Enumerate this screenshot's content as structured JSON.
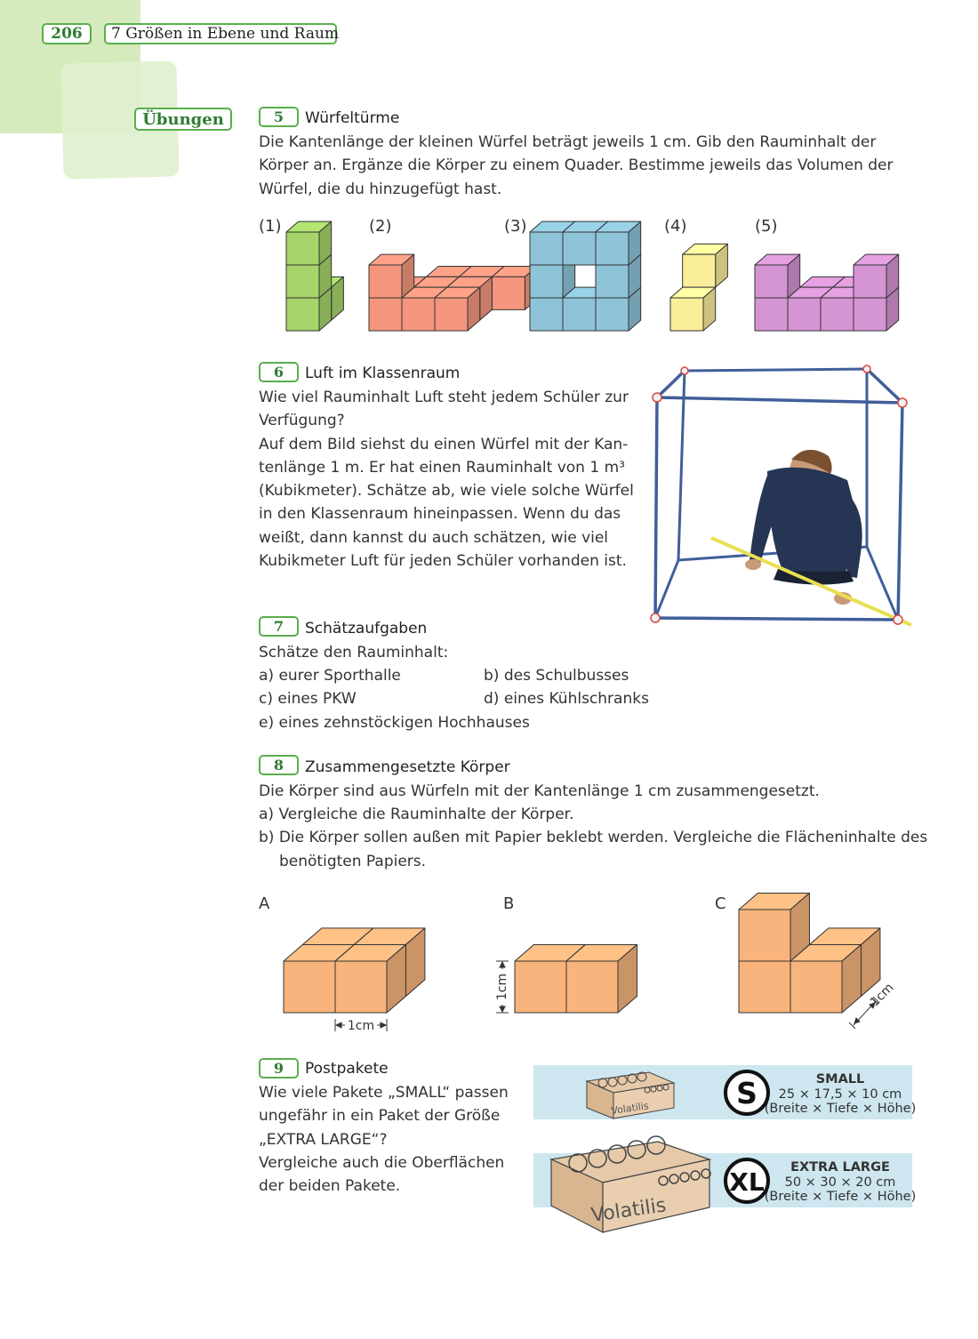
{
  "header": {
    "page_number": "206",
    "chapter": "7  Größen in Ebene und Raum"
  },
  "section_label": "Übungen",
  "ex5": {
    "num": "5",
    "title": "Würfeltürme",
    "lines": [
      "Die Kantenlänge der kleinen Würfel beträgt jeweils 1 cm. Gib den Rauminhalt der",
      "Körper an. Ergänze die Körper zu einem Quader. Bestimme jeweils das Volumen der",
      "Würfel, die du hinzugefügt hast."
    ],
    "figure_labels": [
      "(1)",
      "(2)",
      "(3)",
      "(4)",
      "(5)"
    ],
    "colors": {
      "green": "#a6d46a",
      "red": "#f4967e",
      "blue": "#8ec3d8",
      "yellow": "#fbee9a",
      "purple": "#d594d3"
    }
  },
  "ex6": {
    "num": "6",
    "title": "Luft im Klassenraum",
    "lines": [
      "Wie viel Rauminhalt Luft steht jedem Schüler zur",
      "Verfügung?",
      "Auf dem Bild siehst du einen Würfel mit der Kan-",
      "tenlänge 1 m. Er hat einen Rauminhalt von 1 m³",
      "(Kubikmeter). Schätze ab, wie viele solche Würfel",
      "in den Klassenraum hineinpassen. Wenn du das",
      "weißt, dann kannst du auch schätzen, wie viel",
      "Kubikmeter Luft für jeden Schüler vorhanden ist."
    ]
  },
  "ex7": {
    "num": "7",
    "title": "Schätzaufgaben",
    "intro": "Schätze den Rauminhalt:",
    "items": {
      "a": "a) eurer Sporthalle",
      "b": "b) des Schulbusses",
      "c": "c) eines PKW",
      "d": "d) eines Kühlschranks",
      "e": "e) eines zehnstöckigen Hochhauses"
    }
  },
  "ex8": {
    "num": "8",
    "title": "Zusammengesetzte Körper",
    "lines": [
      "Die Körper sind aus Würfeln mit der Kantenlänge 1 cm zusammengesetzt.",
      "a) Vergleiche die Rauminhalte der Körper.",
      "b) Die Körper sollen außen mit Papier beklebt werden. Vergleiche die Flächeninhalte des",
      "benötigten Papiers."
    ],
    "figure_labels": {
      "a": "A",
      "b": "B",
      "c": "C"
    },
    "dim_label": "1cm",
    "color": "#f8b47c"
  },
  "ex9": {
    "num": "9",
    "title": "Postpakete",
    "lines": [
      "Wie viele Pakete „SMALL“ passen",
      "ungefähr in ein Paket der Größe",
      "„EXTRA LARGE“?",
      "Vergleiche auch die Oberflächen",
      "der beiden Pakete."
    ],
    "small": {
      "badge": "S",
      "name": "SMALL",
      "dims": "25 × 17,5 × 10 cm",
      "sub": "(Breite × Tiefe × Höhe)"
    },
    "xl": {
      "badge": "XL",
      "name": "EXTRA LARGE",
      "dims": "50 × 30 × 20 cm",
      "sub": "(Breite × Tiefe × Höhe)"
    },
    "brand": "Volatilis",
    "panel_color": "#cde6ef"
  }
}
